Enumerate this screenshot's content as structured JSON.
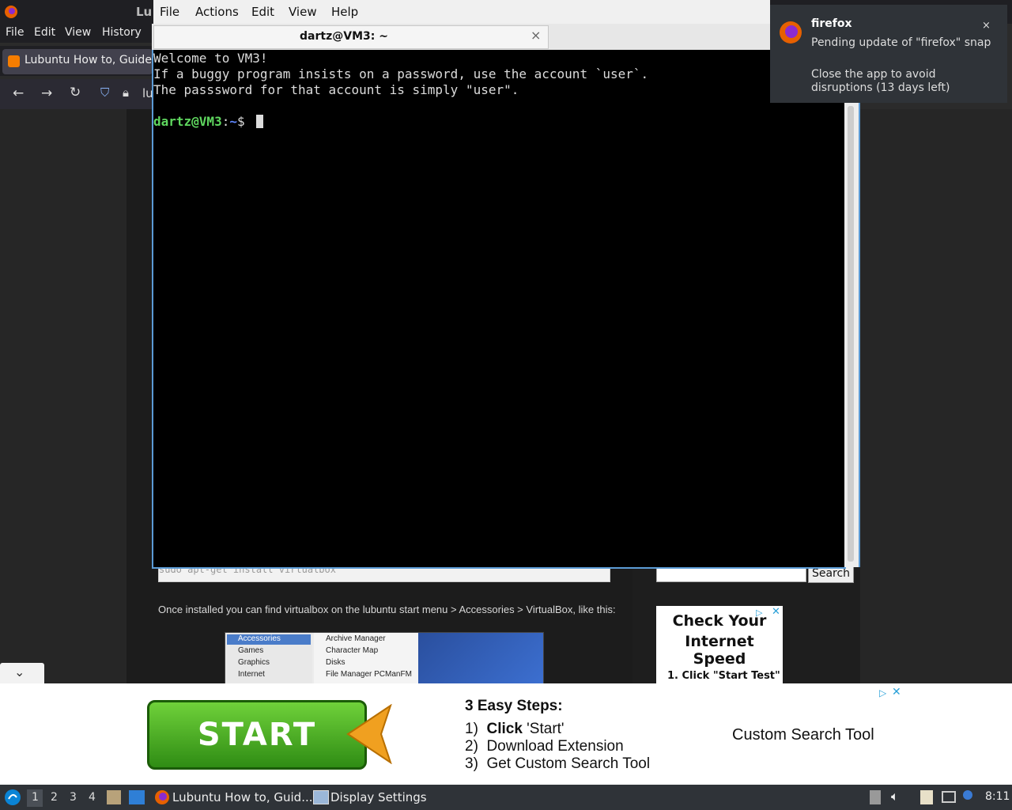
{
  "firefox": {
    "title_partial": "Lu",
    "menu": [
      "File",
      "Edit",
      "View",
      "History"
    ],
    "tab_title": "Lubuntu How to, Guides",
    "url_partial": "lu",
    "page": {
      "code_box": "sudo apt-get install virtualbox",
      "search_button": "Search",
      "paragraph": "Once installed you can find virtualbox on the lubuntu start menu > Accessories > VirtualBox, like this:",
      "menu_screenshot": {
        "left_items": [
          "Accessories",
          "Games",
          "Graphics",
          "Internet"
        ],
        "right_items": [
          "Archive Manager",
          "Character Map",
          "Disks",
          "File Manager PCManFM"
        ]
      },
      "side_ad": {
        "line1": "Check Your",
        "line2": "Internet Speed",
        "line3": "1. Click \"Start Test\""
      }
    }
  },
  "terminal": {
    "menu": [
      "File",
      "Actions",
      "Edit",
      "View",
      "Help"
    ],
    "tab_title": "dartz@VM3: ~",
    "lines": [
      "Welcome to VM3!",
      "If a buggy program insists on a password, use the account `user`.",
      "The passsword for that account is simply \"user\"."
    ],
    "prompt_user": "dartz@VM3",
    "prompt_path": "~",
    "prompt_symbol": "$"
  },
  "notification": {
    "app": "firefox",
    "body1": "Pending update of \"firefox\" snap",
    "body2": "Close the app to avoid disruptions (13 days left)",
    "close": "×"
  },
  "bottom_ad": {
    "start_label": "START",
    "steps_title": "3 Easy Steps:",
    "step1_num": "1)",
    "step1_bold": "Click",
    "step1_rest": " 'Start'",
    "step2": "2)  Download Extension",
    "step3": "3)  Get Custom Search Tool",
    "right_text": "Custom Search Tool"
  },
  "taskbar": {
    "desktops": [
      "1",
      "2",
      "3",
      "4"
    ],
    "task1": "Lubuntu How to, Guid...",
    "task2": "Display Settings",
    "clock": "8:11"
  },
  "colors": {
    "terminal_bg": "#000000",
    "prompt_green": "#5fd75f",
    "prompt_blue": "#5f87ff",
    "accent_border": "#5b9bd5"
  }
}
